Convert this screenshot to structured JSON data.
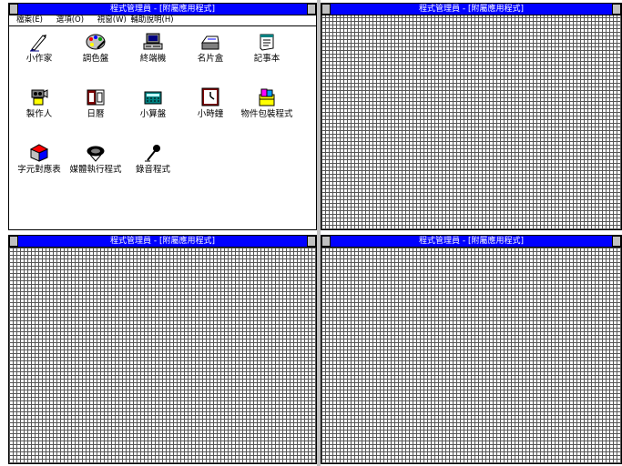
{
  "window_title": "程式管理員 - [附屬應用程式]",
  "menu": [
    "檔案(E)",
    "選項(O)",
    "視窗(W)",
    "輔助說明(H)"
  ],
  "icons": [
    {
      "label": "小作家",
      "icon": "write-icon"
    },
    {
      "label": "調色盤",
      "icon": "paintbrush-icon"
    },
    {
      "label": "終端機",
      "icon": "terminal-icon"
    },
    {
      "label": "名片盒",
      "icon": "cardfile-icon"
    },
    {
      "label": "記事本",
      "icon": "notepad-icon"
    },
    {
      "label": "製作人",
      "icon": "recorder-icon"
    },
    {
      "label": "日曆",
      "icon": "calendar-icon"
    },
    {
      "label": "小算盤",
      "icon": "calculator-icon"
    },
    {
      "label": "小時鐘",
      "icon": "clock-icon"
    },
    {
      "label": "物件包裝程式",
      "icon": "object-packager-icon"
    },
    {
      "label": "字元對應表",
      "icon": "character-map-icon"
    },
    {
      "label": "媒體執行程式",
      "icon": "media-player-icon"
    },
    {
      "label": "錄音程式",
      "icon": "sound-recorder-icon"
    }
  ],
  "colors": {
    "titlebar": "#0000ff",
    "pattern": "#555555"
  }
}
